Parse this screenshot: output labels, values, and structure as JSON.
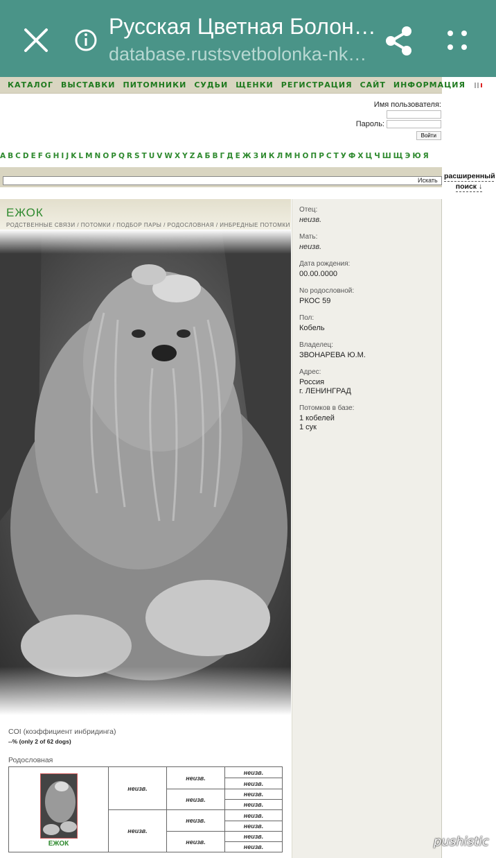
{
  "browser": {
    "title": "Русская Цветная Болон…",
    "url": "database.rustsvetbolonka-nk…"
  },
  "nav": {
    "items": [
      "КАТАЛОГ",
      "ВЫСТАВКИ",
      "ПИТОМНИКИ",
      "СУДЬИ",
      "ЩЕНКИ",
      "РЕГИСТРАЦИЯ",
      "САЙТ",
      "ИНФОРМАЦИЯ"
    ]
  },
  "login": {
    "username_label": "Имя пользователя:",
    "password_label": "Пароль:",
    "button": "Войти"
  },
  "alphabet": [
    "A",
    "B",
    "C",
    "D",
    "E",
    "F",
    "G",
    "H",
    "I",
    "J",
    "K",
    "L",
    "M",
    "N",
    "O",
    "P",
    "Q",
    "R",
    "S",
    "T",
    "U",
    "V",
    "W",
    "X",
    "Y",
    "Z",
    "А",
    "Б",
    "В",
    "Г",
    "Д",
    "Е",
    "Ж",
    "З",
    "И",
    "К",
    "Л",
    "М",
    "Н",
    "О",
    "П",
    "Р",
    "С",
    "Т",
    "У",
    "Ф",
    "Х",
    "Ц",
    "Ч",
    "Ш",
    "Щ",
    "Э",
    "Ю",
    "Я"
  ],
  "search": {
    "button": "Искать",
    "advanced_line1": "расширенный",
    "advanced_line2": "поиск ↓"
  },
  "dog": {
    "name": "ЕЖОК",
    "links": "РОДСТВЕННЫЕ СВЯЗИ / ПОТОМКИ / ПОДБОР ПАРЫ / РОДОСЛОВНАЯ / ИНБРЕДНЫЕ ПОТОМКИ"
  },
  "info": {
    "father_label": "Отец:",
    "father_value": "неизв.",
    "mother_label": "Мать:",
    "mother_value": "неизв.",
    "birth_label": "Дата рождения:",
    "birth_value": "00.00.0000",
    "pedigree_no_label": "No родословной:",
    "pedigree_no_value": "РКОС 59",
    "sex_label": "Пол:",
    "sex_value": "Кобель",
    "owner_label": "Владелец:",
    "owner_value": "ЗВОНАРЕВА Ю.М.",
    "address_label": "Адрес:",
    "address_line1": "Россия",
    "address_line2": "г. ЛЕНИНГРАД",
    "offspring_label": "Потомков в базе:",
    "offspring_males": "1 кобелей",
    "offspring_females": "1 сук"
  },
  "coi": {
    "abbr": "COI",
    "label": "(коэффициент инбридинга)",
    "value": "--% (only 2 of 62 dogs)"
  },
  "pedigree": {
    "label": "Родословная",
    "self_name": "ЕЖОК",
    "unknown": "неизв."
  },
  "watermark": "pushistic"
}
